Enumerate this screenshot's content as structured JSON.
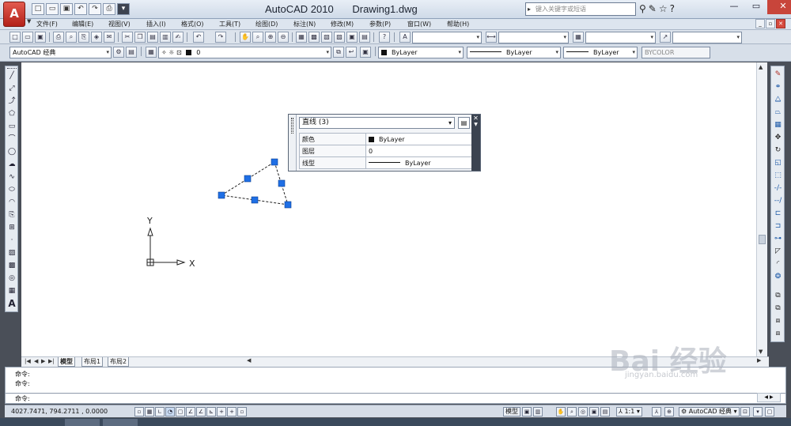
{
  "app": {
    "logo_letter": "A",
    "title": "AutoCAD 2010",
    "filename": "Drawing1.dwg",
    "search_placeholder": "键入关键字或短语"
  },
  "menu": [
    "文件(F)",
    "编辑(E)",
    "视图(V)",
    "插入(I)",
    "格式(O)",
    "工具(T)",
    "绘图(D)",
    "标注(N)",
    "修改(M)",
    "参数(P)",
    "窗口(W)",
    "帮助(H)"
  ],
  "toolbar2": {
    "workspace": "AutoCAD 经典",
    "layer": "0",
    "color": "ByLayer",
    "linetype": "ByLayer",
    "lineweight": "ByLayer",
    "plotstyle": "BYCOLOR"
  },
  "ucs": {
    "y_label": "Y",
    "x_label": "X"
  },
  "properties_palette": {
    "selection": "直线 (3)",
    "rows": [
      {
        "key": "颜色",
        "value": "ByLayer"
      },
      {
        "key": "图层",
        "value": "0"
      },
      {
        "key": "线型",
        "value": "ByLayer"
      }
    ]
  },
  "tabs": [
    "模型",
    "布局1",
    "布局2"
  ],
  "command": {
    "history": [
      "命令:",
      "命令:"
    ],
    "prompt": "命令:"
  },
  "status": {
    "coords": "4027.7471,  794.2711  , 0.0000",
    "model_label": "模型",
    "scale": "1:1",
    "workspace": "AutoCAD 经典"
  },
  "watermark": {
    "main": "Bai 经验",
    "sub": "jingyan.baidu.com"
  },
  "colors": {
    "grip": "#1f6fe5",
    "canvas": "#ffffff",
    "app_red": "#c8453b"
  }
}
